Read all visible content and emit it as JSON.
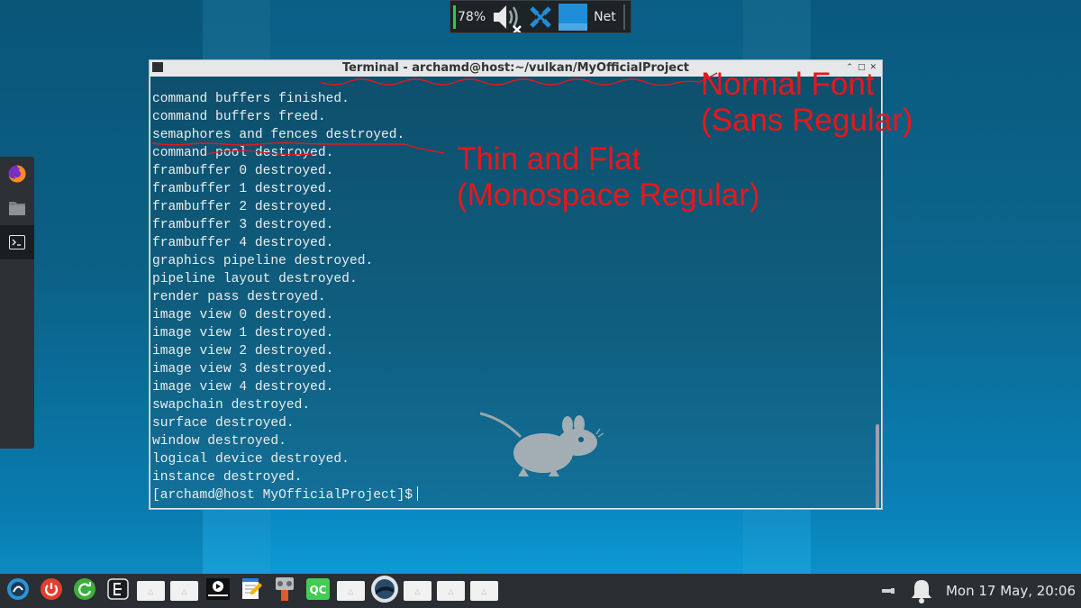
{
  "top_panel": {
    "battery_percent": "78%",
    "battery_level": 0.78,
    "net_label": "Net"
  },
  "left_dock": {
    "items": [
      {
        "icon": "firefox-icon"
      },
      {
        "icon": "folder-icon"
      },
      {
        "icon": "terminal-icon",
        "active": true
      }
    ]
  },
  "terminal": {
    "title": "Terminal - archamd@host:~/vulkan/MyOfficialProject",
    "window_controls": [
      "⌃",
      "□",
      "✕"
    ],
    "lines": [
      "command buffers finished.",
      "command buffers freed.",
      "semaphores and fences destroyed.",
      "command pool destroyed.",
      "frambuffer 0 destroyed.",
      "frambuffer 1 destroyed.",
      "frambuffer 2 destroyed.",
      "frambuffer 3 destroyed.",
      "frambuffer 4 destroyed.",
      "graphics pipeline destroyed.",
      "pipeline layout destroyed.",
      "render pass destroyed.",
      "image view 0 destroyed.",
      "image view 1 destroyed.",
      "image view 2 destroyed.",
      "image view 3 destroyed.",
      "image view 4 destroyed.",
      "swapchain destroyed.",
      "surface destroyed.",
      "window destroyed.",
      "logical device destroyed.",
      "instance destroyed."
    ],
    "prompt": "[archamd@host MyOfficialProject]$"
  },
  "annotations": {
    "normal_font": "Normal Font\n(Sans Regular)",
    "thin_font": "Thin and Flat\n(Monospace Regular)",
    "color": "#e8171a"
  },
  "taskbar": {
    "launchers": [
      {
        "icon": "xfce-menu-icon"
      },
      {
        "icon": "power-icon"
      },
      {
        "icon": "refresh-icon"
      },
      {
        "icon": "exit-icon"
      },
      {
        "icon": "placeholder-icon"
      },
      {
        "icon": "placeholder-icon"
      },
      {
        "icon": "media-player-icon"
      },
      {
        "icon": "text-editor-icon"
      },
      {
        "icon": "network-tool-icon"
      },
      {
        "icon": "qt-creator-icon",
        "label": "QC"
      },
      {
        "icon": "placeholder-icon"
      },
      {
        "icon": "obs-icon"
      },
      {
        "icon": "placeholder-icon"
      },
      {
        "icon": "placeholder-icon"
      },
      {
        "icon": "placeholder-icon"
      }
    ],
    "clock": "Mon 17 May, 20:06"
  },
  "colors": {
    "panel_bg": "#2b2f33",
    "battery_green": "#2ecc40",
    "terminal_fg": "#e9eef0",
    "accent_blue": "#1e8ed8"
  }
}
